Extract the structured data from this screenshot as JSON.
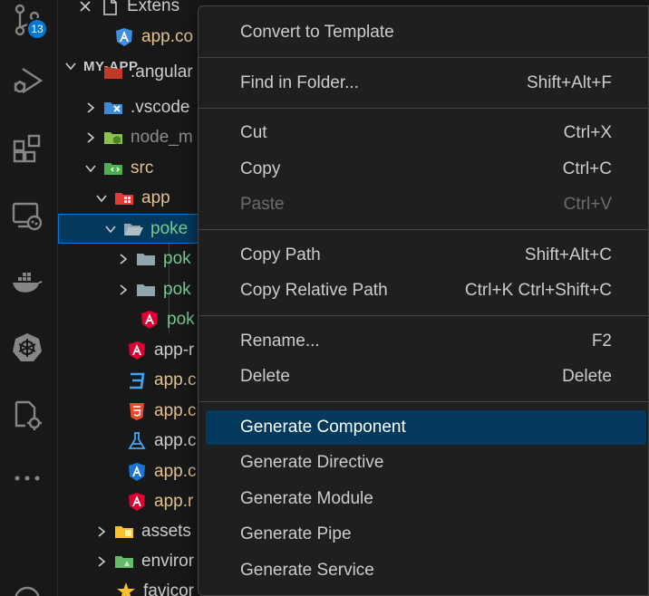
{
  "activity_bar": {
    "items": [
      {
        "name": "source-control",
        "badge": "13"
      },
      {
        "name": "run-and-debug"
      },
      {
        "name": "extensions"
      },
      {
        "name": "remote-explorer"
      },
      {
        "name": "docker"
      },
      {
        "name": "kubernetes"
      },
      {
        "name": "settings-sync"
      },
      {
        "name": "more"
      }
    ]
  },
  "explorer": {
    "open_editors": [
      {
        "label": "Extens",
        "icon": "file-icon"
      },
      {
        "label": "app.co",
        "icon": "angular-icon"
      }
    ],
    "section_title": "MY-APP",
    "tree": [
      {
        "label": ".angular",
        "icon": "angular-folder-icon"
      },
      {
        "label": ".vscode",
        "icon": "vscode-folder-icon"
      },
      {
        "label": "node_m",
        "icon": "node-folder-icon"
      },
      {
        "label": "src",
        "icon": "src-folder-icon"
      },
      {
        "label": "app",
        "icon": "app-folder-icon"
      },
      {
        "label": "poke",
        "icon": "folder-open-icon"
      },
      {
        "label": "pok",
        "icon": "folder-icon"
      },
      {
        "label": "pok",
        "icon": "folder-icon"
      },
      {
        "label": "pok",
        "icon": "angular-icon"
      },
      {
        "label": "app-r",
        "icon": "angular-icon"
      },
      {
        "label": "app.c",
        "icon": "css-icon"
      },
      {
        "label": "app.c",
        "icon": "html-icon"
      },
      {
        "label": "app.c",
        "icon": "test-icon"
      },
      {
        "label": "app.c",
        "icon": "angular-blue-icon"
      },
      {
        "label": "app.r",
        "icon": "angular-icon"
      },
      {
        "label": "assets",
        "icon": "assets-folder-icon"
      },
      {
        "label": "enviror",
        "icon": "env-folder-icon"
      },
      {
        "label": "favicor",
        "icon": "star-icon"
      }
    ]
  },
  "context_menu": {
    "items": [
      {
        "label": "Convert to Template",
        "shortcut": ""
      },
      {
        "label": "Find in Folder...",
        "shortcut": "Shift+Alt+F"
      },
      {
        "label": "Cut",
        "shortcut": "Ctrl+X"
      },
      {
        "label": "Copy",
        "shortcut": "Ctrl+C"
      },
      {
        "label": "Paste",
        "shortcut": "Ctrl+V"
      },
      {
        "label": "Copy Path",
        "shortcut": "Shift+Alt+C"
      },
      {
        "label": "Copy Relative Path",
        "shortcut": "Ctrl+K Ctrl+Shift+C"
      },
      {
        "label": "Rename...",
        "shortcut": "F2"
      },
      {
        "label": "Delete",
        "shortcut": "Delete"
      },
      {
        "label": "Generate Component",
        "shortcut": ""
      },
      {
        "label": "Generate Directive",
        "shortcut": ""
      },
      {
        "label": "Generate Module",
        "shortcut": ""
      },
      {
        "label": "Generate Pipe",
        "shortcut": ""
      },
      {
        "label": "Generate Service",
        "shortcut": ""
      }
    ]
  },
  "colors": {
    "accent": "#0078d4",
    "selection": "#04395e",
    "git_added": "#73c991",
    "angular_red": "#dd0031"
  }
}
